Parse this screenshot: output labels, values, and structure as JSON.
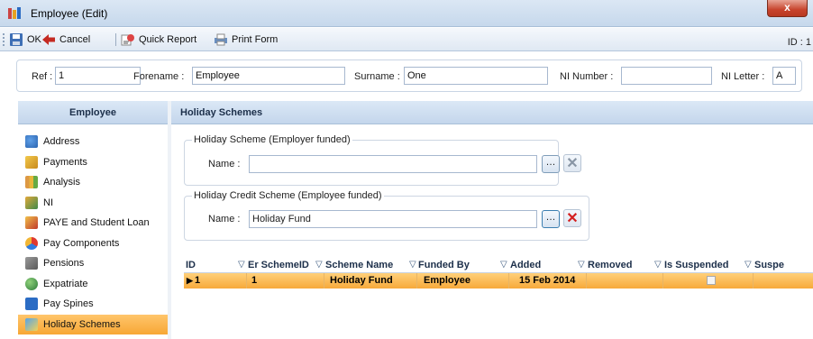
{
  "window": {
    "title": "Employee (Edit)",
    "close_glyph": "x"
  },
  "toolbar": {
    "ok_label": "OK",
    "cancel_label": "Cancel",
    "quick_report_label": "Quick Report",
    "print_form_label": "Print Form",
    "id_label": "ID : 1"
  },
  "header": {
    "ref_label": "Ref :",
    "ref_value": "1",
    "forename_label": "Forename :",
    "forename_value": "Employee",
    "surname_label": "Surname :",
    "surname_value": "One",
    "ni_number_label": "NI Number :",
    "ni_number_value": "",
    "ni_letter_label": "NI Letter :",
    "ni_letter_value": "A"
  },
  "sidebar": {
    "title": "Employee",
    "items": [
      {
        "label": "Address",
        "icon": "people-icon"
      },
      {
        "label": "Payments",
        "icon": "payments-icon"
      },
      {
        "label": "Analysis",
        "icon": "analysis-icon"
      },
      {
        "label": "NI",
        "icon": "ni-icon"
      },
      {
        "label": "PAYE and Student Loan",
        "icon": "paye-icon"
      },
      {
        "label": "Pay Components",
        "icon": "pay-components-icon"
      },
      {
        "label": "Pensions",
        "icon": "pensions-icon"
      },
      {
        "label": "Expatriate",
        "icon": "expatriate-icon"
      },
      {
        "label": "Pay Spines",
        "icon": "pay-spines-icon"
      },
      {
        "label": "Holiday Schemes",
        "icon": "holiday-icon",
        "selected": true
      }
    ]
  },
  "main": {
    "title": "Holiday Schemes",
    "employer_group": {
      "title": "Holiday Scheme (Employer funded)",
      "name_label": "Name :",
      "name_value": ""
    },
    "employee_group": {
      "title": "Holiday Credit Scheme (Employee funded)",
      "name_label": "Name :",
      "name_value": "Holiday Fund"
    },
    "grid": {
      "columns": [
        "ID",
        "Er SchemeID",
        "Scheme Name",
        "Funded By",
        "Added",
        "Removed",
        "Is Suspended",
        "Suspe"
      ],
      "rows": [
        {
          "id": "1",
          "er_scheme_id": "1",
          "scheme_name": "Holiday Fund",
          "funded_by": "Employee",
          "added": "15 Feb 2014",
          "removed": "",
          "is_suspended": false
        }
      ]
    }
  },
  "colors": {
    "selection": "#f7a935",
    "header": "#c4d6ec",
    "delete_red": "#d42020"
  }
}
